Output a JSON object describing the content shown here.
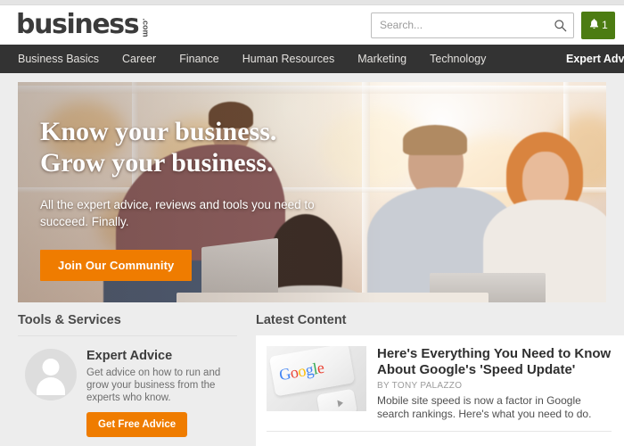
{
  "site": {
    "logo_word": "business",
    "logo_tld": ".com"
  },
  "search": {
    "placeholder": "Search...",
    "value": "",
    "icon": "search-icon"
  },
  "notifications": {
    "icon": "bell-icon",
    "count": "1",
    "color": "#4c7c12"
  },
  "nav": {
    "items": [
      {
        "label": "Business Basics"
      },
      {
        "label": "Career"
      },
      {
        "label": "Finance"
      },
      {
        "label": "Human Resources"
      },
      {
        "label": "Marketing"
      },
      {
        "label": "Technology"
      }
    ],
    "right_item": {
      "label": "Expert Advi"
    },
    "background": "#333333"
  },
  "hero": {
    "title_line1": "Know your business.",
    "title_line2": "Grow your business.",
    "subtitle": "All the expert advice, reviews and tools you need to succeed. Finally.",
    "cta_label": "Join Our Community",
    "cta_color": "#ef7c00"
  },
  "tools": {
    "section_title": "Tools & Services",
    "card": {
      "icon": "user-avatar-icon",
      "title": "Expert Advice",
      "description": "Get advice on how to run and grow your business from the experts who know.",
      "button_label": "Get Free Advice"
    }
  },
  "latest_content": {
    "section_title": "Latest Content",
    "articles": [
      {
        "thumbnail": "google-keyboard-key-image",
        "title": "Here's Everything You Need to Know About Google's 'Speed Update'",
        "byline": "BY TONY PALAZZO",
        "excerpt": "Mobile site speed is now a factor in Google search rankings. Here's what you need to do.",
        "logo_letters": [
          "G",
          "o",
          "o",
          "g",
          "l",
          "e"
        ]
      }
    ]
  }
}
